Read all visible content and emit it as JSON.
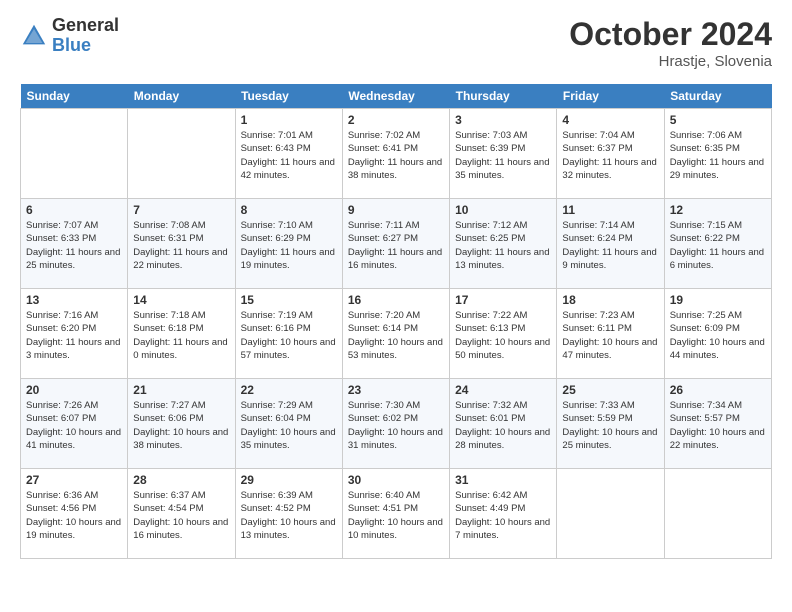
{
  "header": {
    "logo_general": "General",
    "logo_blue": "Blue",
    "month_title": "October 2024",
    "location": "Hrastje, Slovenia"
  },
  "days_of_week": [
    "Sunday",
    "Monday",
    "Tuesday",
    "Wednesday",
    "Thursday",
    "Friday",
    "Saturday"
  ],
  "weeks": [
    [
      {
        "day": "",
        "info": ""
      },
      {
        "day": "",
        "info": ""
      },
      {
        "day": "1",
        "info": "Sunrise: 7:01 AM\nSunset: 6:43 PM\nDaylight: 11 hours\nand 42 minutes."
      },
      {
        "day": "2",
        "info": "Sunrise: 7:02 AM\nSunset: 6:41 PM\nDaylight: 11 hours\nand 38 minutes."
      },
      {
        "day": "3",
        "info": "Sunrise: 7:03 AM\nSunset: 6:39 PM\nDaylight: 11 hours\nand 35 minutes."
      },
      {
        "day": "4",
        "info": "Sunrise: 7:04 AM\nSunset: 6:37 PM\nDaylight: 11 hours\nand 32 minutes."
      },
      {
        "day": "5",
        "info": "Sunrise: 7:06 AM\nSunset: 6:35 PM\nDaylight: 11 hours\nand 29 minutes."
      }
    ],
    [
      {
        "day": "6",
        "info": "Sunrise: 7:07 AM\nSunset: 6:33 PM\nDaylight: 11 hours\nand 25 minutes."
      },
      {
        "day": "7",
        "info": "Sunrise: 7:08 AM\nSunset: 6:31 PM\nDaylight: 11 hours\nand 22 minutes."
      },
      {
        "day": "8",
        "info": "Sunrise: 7:10 AM\nSunset: 6:29 PM\nDaylight: 11 hours\nand 19 minutes."
      },
      {
        "day": "9",
        "info": "Sunrise: 7:11 AM\nSunset: 6:27 PM\nDaylight: 11 hours\nand 16 minutes."
      },
      {
        "day": "10",
        "info": "Sunrise: 7:12 AM\nSunset: 6:25 PM\nDaylight: 11 hours\nand 13 minutes."
      },
      {
        "day": "11",
        "info": "Sunrise: 7:14 AM\nSunset: 6:24 PM\nDaylight: 11 hours\nand 9 minutes."
      },
      {
        "day": "12",
        "info": "Sunrise: 7:15 AM\nSunset: 6:22 PM\nDaylight: 11 hours\nand 6 minutes."
      }
    ],
    [
      {
        "day": "13",
        "info": "Sunrise: 7:16 AM\nSunset: 6:20 PM\nDaylight: 11 hours\nand 3 minutes."
      },
      {
        "day": "14",
        "info": "Sunrise: 7:18 AM\nSunset: 6:18 PM\nDaylight: 11 hours\nand 0 minutes."
      },
      {
        "day": "15",
        "info": "Sunrise: 7:19 AM\nSunset: 6:16 PM\nDaylight: 10 hours\nand 57 minutes."
      },
      {
        "day": "16",
        "info": "Sunrise: 7:20 AM\nSunset: 6:14 PM\nDaylight: 10 hours\nand 53 minutes."
      },
      {
        "day": "17",
        "info": "Sunrise: 7:22 AM\nSunset: 6:13 PM\nDaylight: 10 hours\nand 50 minutes."
      },
      {
        "day": "18",
        "info": "Sunrise: 7:23 AM\nSunset: 6:11 PM\nDaylight: 10 hours\nand 47 minutes."
      },
      {
        "day": "19",
        "info": "Sunrise: 7:25 AM\nSunset: 6:09 PM\nDaylight: 10 hours\nand 44 minutes."
      }
    ],
    [
      {
        "day": "20",
        "info": "Sunrise: 7:26 AM\nSunset: 6:07 PM\nDaylight: 10 hours\nand 41 minutes."
      },
      {
        "day": "21",
        "info": "Sunrise: 7:27 AM\nSunset: 6:06 PM\nDaylight: 10 hours\nand 38 minutes."
      },
      {
        "day": "22",
        "info": "Sunrise: 7:29 AM\nSunset: 6:04 PM\nDaylight: 10 hours\nand 35 minutes."
      },
      {
        "day": "23",
        "info": "Sunrise: 7:30 AM\nSunset: 6:02 PM\nDaylight: 10 hours\nand 31 minutes."
      },
      {
        "day": "24",
        "info": "Sunrise: 7:32 AM\nSunset: 6:01 PM\nDaylight: 10 hours\nand 28 minutes."
      },
      {
        "day": "25",
        "info": "Sunrise: 7:33 AM\nSunset: 5:59 PM\nDaylight: 10 hours\nand 25 minutes."
      },
      {
        "day": "26",
        "info": "Sunrise: 7:34 AM\nSunset: 5:57 PM\nDaylight: 10 hours\nand 22 minutes."
      }
    ],
    [
      {
        "day": "27",
        "info": "Sunrise: 6:36 AM\nSunset: 4:56 PM\nDaylight: 10 hours\nand 19 minutes."
      },
      {
        "day": "28",
        "info": "Sunrise: 6:37 AM\nSunset: 4:54 PM\nDaylight: 10 hours\nand 16 minutes."
      },
      {
        "day": "29",
        "info": "Sunrise: 6:39 AM\nSunset: 4:52 PM\nDaylight: 10 hours\nand 13 minutes."
      },
      {
        "day": "30",
        "info": "Sunrise: 6:40 AM\nSunset: 4:51 PM\nDaylight: 10 hours\nand 10 minutes."
      },
      {
        "day": "31",
        "info": "Sunrise: 6:42 AM\nSunset: 4:49 PM\nDaylight: 10 hours\nand 7 minutes."
      },
      {
        "day": "",
        "info": ""
      },
      {
        "day": "",
        "info": ""
      }
    ]
  ]
}
